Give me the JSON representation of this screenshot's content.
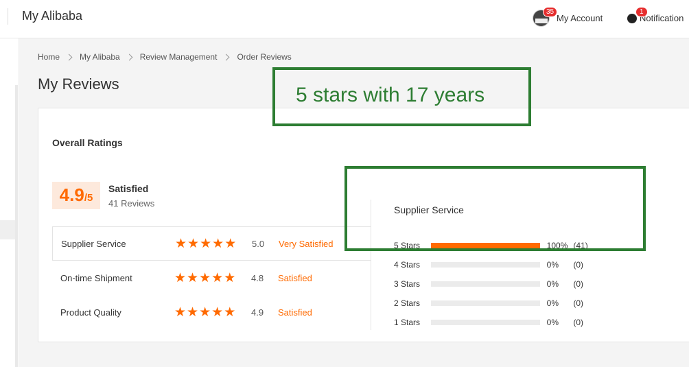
{
  "topbar": {
    "brand": "My Alibaba",
    "account_badge": "35",
    "account_label": "My Account",
    "notification_badge": "1",
    "notification_label": "Notification"
  },
  "breadcrumb": [
    "Home",
    "My Alibaba",
    "Review Management",
    "Order Reviews"
  ],
  "page_title": "My Reviews",
  "overall": {
    "title": "Overall Ratings",
    "score": "4.9",
    "score_max": "/5",
    "status": "Satisfied",
    "count": "41 Reviews"
  },
  "rating_rows": [
    {
      "label": "Supplier Service",
      "score": "5.0",
      "status": "Very Satisfied",
      "stars": 5
    },
    {
      "label": "On-time Shipment",
      "score": "4.8",
      "status": "Satisfied",
      "stars": 5
    },
    {
      "label": "Product Quality",
      "score": "4.9",
      "status": "Satisfied",
      "stars": 5
    }
  ],
  "distribution": {
    "title": "Supplier Service",
    "rows": [
      {
        "label": "5  Stars",
        "pct_value": 100,
        "pct": "100%",
        "count": "(41)"
      },
      {
        "label": "4  Stars",
        "pct_value": 0,
        "pct": "0%",
        "count": "(0)"
      },
      {
        "label": "3  Stars",
        "pct_value": 0,
        "pct": "0%",
        "count": "(0)"
      },
      {
        "label": "2  Stars",
        "pct_value": 0,
        "pct": "0%",
        "count": "(0)"
      },
      {
        "label": "1  Stars",
        "pct_value": 0,
        "pct": "0%",
        "count": "(0)"
      }
    ]
  },
  "annotation": {
    "text": "5 stars with 17 years",
    "color": "#2d7d32"
  },
  "colors": {
    "accent": "#ff6a00",
    "badge": "#e62e2e"
  }
}
